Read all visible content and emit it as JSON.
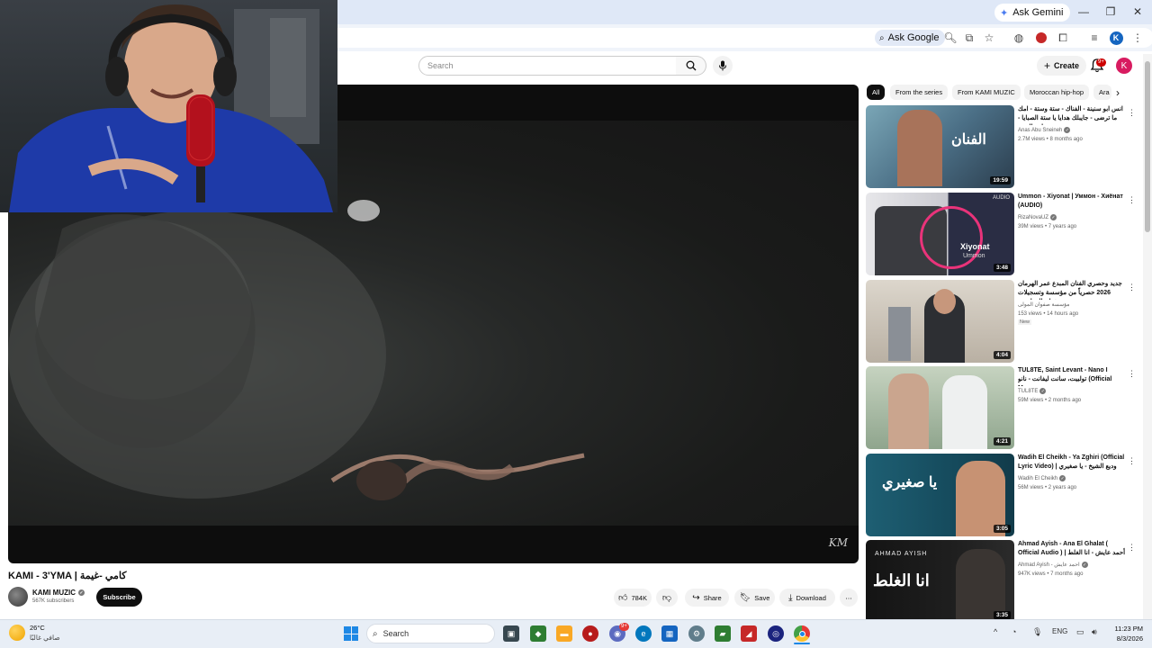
{
  "browser": {
    "ask_gemini": "Ask Gemini",
    "ask_google": "Ask Google",
    "profile_initial": "K",
    "window_controls": [
      "minimize",
      "restore",
      "close"
    ]
  },
  "youtube": {
    "search_placeholder": "Search",
    "create_label": "Create",
    "notification_count": "9+",
    "avatar_initial": "K"
  },
  "video": {
    "title": "KAMI - 3'YMA | كامي -غيمة",
    "channel": "KAMI MUZIC",
    "subscribers": "567K subscribers",
    "subscribe_label": "Subscribe",
    "likes": "784K",
    "share_label": "Share",
    "save_label": "Save",
    "download_label": "Download",
    "watermark": "KM"
  },
  "chips": [
    "All",
    "From the series",
    "From KAMI MUZIC",
    "Moroccan hip-hop",
    "Ara"
  ],
  "recommendations": [
    {
      "title": "انس ابو سنينة - الفناك - ستة وستة - امك ما ترضى - جايبلك هدايا يا ستة الصبايا - جاني الهوى",
      "channel": "Anas Abu Sneineh",
      "verified": true,
      "meta": "2.7M views • 8 months ago",
      "duration": "19:59",
      "new": "",
      "thumb_text": "الفنان"
    },
    {
      "title": "Ummon - Xiyonat | Уммон - Хиёнат (AUDIO)",
      "channel": "RizaNovaUZ",
      "verified": true,
      "meta": "39M views • 7 years ago",
      "duration": "3:48",
      "new": "",
      "thumb_text": "Xiyonat",
      "thumb_sub": "Ummon",
      "thumb_badge": "AUDIO"
    },
    {
      "title": "جديد وحصري الفنان المبدع عمر الهرمان 2026 حصرياً من مؤسسة وتسجيلات صفوان المولى ...",
      "channel": "مؤسسة صفوان المولى",
      "verified": false,
      "meta": "153 views • 14 hours ago",
      "duration": "4:04",
      "new": "New",
      "thumb_text": ""
    },
    {
      "title": "TUL8TE, Saint Levant - Nano I تولبيت، سانت ليفانت - نانو (Official Mus...",
      "channel": "TUL8TE",
      "verified": true,
      "meta": "59M views • 2 months ago",
      "duration": "4:21",
      "new": "",
      "thumb_text": ""
    },
    {
      "title": "Wadih El Cheikh - Ya Zghiri (Official Lyric Video) | وديع الشيخ - يا صغيري",
      "channel": "Wadih El Cheikh",
      "verified": true,
      "meta": "56M views • 2 years ago",
      "duration": "3:05",
      "new": "",
      "thumb_text": "يا صغيري"
    },
    {
      "title": "Ahmad Ayish - Ana El Ghalat ( Official Audio ) | أحمد عايش - انا الغلط",
      "channel": "Ahmad Ayish - احمد عايش",
      "verified": true,
      "meta": "947K views • 7 months ago",
      "duration": "3:35",
      "new": "",
      "thumb_text": "انا الغلط",
      "thumb_sub": "AHMAD AYISH"
    }
  ],
  "taskbar": {
    "temperature": "26°C",
    "weather_desc": "صافي غالبًا",
    "search_label": "Search",
    "language": "ENG",
    "time": "11:23 PM",
    "date": "8/3/2026",
    "store_badge": "9+"
  },
  "colors": {
    "chrome_titlebar": "#dfe8f7",
    "chrome_toolbar": "#f0f4fa",
    "youtube_red": "#ff0000",
    "subscribe_bg": "#0f0f0f",
    "taskbar_bg": "#e8eef6"
  }
}
